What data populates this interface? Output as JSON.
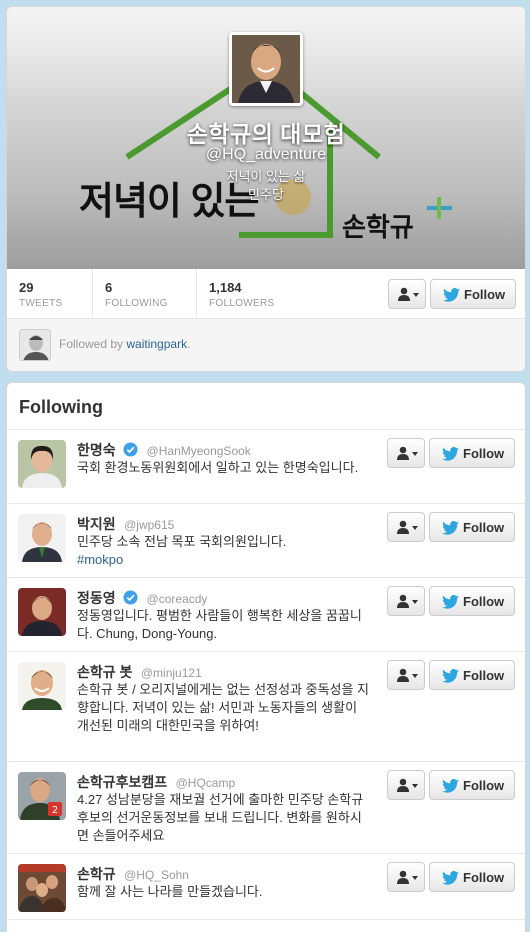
{
  "profile": {
    "name": "손학규의 대모험",
    "handle": "@HQ_adventure",
    "bio_line1": "저녁이 있는 삶",
    "bio_line2": "민주당",
    "banner_slogan": "저녁이 있는",
    "banner_brand": "손학규",
    "stats": [
      {
        "value": "29",
        "label": "TWEETS"
      },
      {
        "value": "6",
        "label": "FOLLOWING"
      },
      {
        "value": "1,184",
        "label": "FOLLOWERS"
      }
    ],
    "followed_by_prefix": "Followed by ",
    "followed_by_user": "waitingpark",
    "followed_by_suffix": ".",
    "follow_label": "Follow"
  },
  "following": {
    "title": "Following",
    "follow_label": "Follow",
    "users": [
      {
        "name": "한명숙",
        "verified": true,
        "handle": "@HanMyeongSook",
        "bio": "국회 환경노동위원회에서 일하고 있는 한명숙입니다."
      },
      {
        "name": "박지원",
        "verified": false,
        "handle": "@jwp615",
        "bio": "민주당 소속 전남 목포 국회의원입니다.",
        "tag": "#mokpo"
      },
      {
        "name": "정동영",
        "verified": true,
        "handle": "@coreacdy",
        "bio": "정동영입니다. 평범한 사람들이 행복한 세상을 꿈꿉니다. Chung, Dong-Young."
      },
      {
        "name": "손학규 봇",
        "verified": false,
        "handle": "@minju121",
        "bio": "손학규 봇 / 오리지널에게는 없는 선정성과 중독성을 지향합니다. 저녁이 있는 삶! 서민과 노동자들의 생활이 개선된 미래의 대한민국을 위하여!"
      },
      {
        "name": "손학규후보캠프",
        "verified": false,
        "handle": "@HQcamp",
        "bio": "4.27 성남분당을 재보궐 선거에 출마한 민주당 손학규 후보의 선거운동정보를 보내 드립니다. 변화를 원하시면 손들어주세요"
      },
      {
        "name": "손학규",
        "verified": false,
        "handle": "@HQ_Sohn",
        "bio": "함께 잘 사는 나라를 만들겠습니다."
      }
    ]
  },
  "colors": {
    "page_bg": "#c0deed",
    "link": "#2a6496",
    "twitter_blue": "#2ba6e1",
    "verified": "#3ea0e8",
    "banner_green": "#4a9a30"
  },
  "icons": [
    "user-icon",
    "twitter-bird-icon",
    "verified-badge-icon",
    "caret-down-icon"
  ]
}
